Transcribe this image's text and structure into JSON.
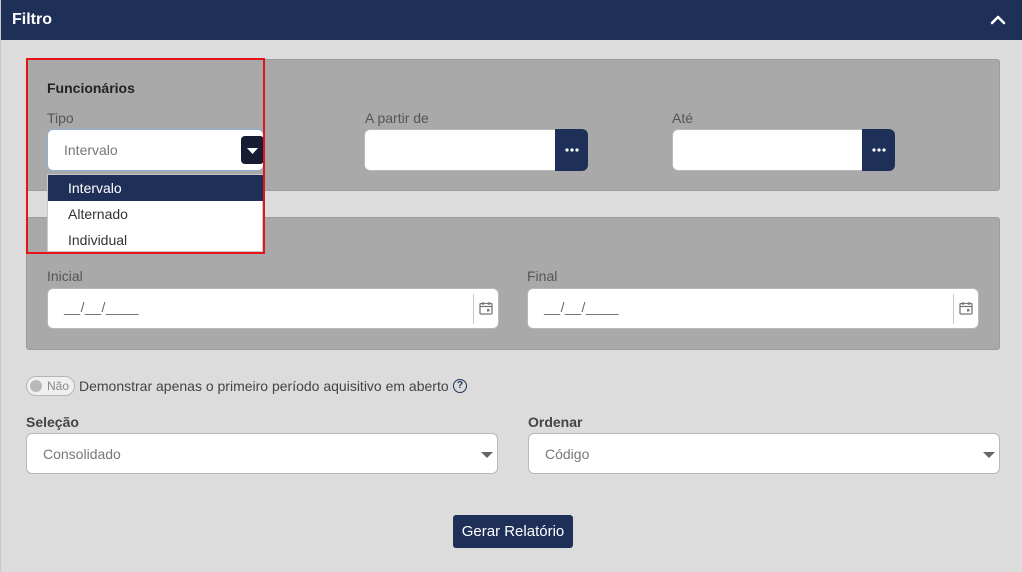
{
  "header": {
    "title": "Filtro",
    "collapse_icon": "chevron-up-icon"
  },
  "funcionarios": {
    "title": "Funcionários",
    "tipo_label": "Tipo",
    "tipo_value": "Intervalo",
    "a_partir_label": "A partir de",
    "a_partir_value": "",
    "ate_label": "Até",
    "ate_value": "",
    "more_icon": "ellipsis-icon"
  },
  "tipo_dropdown": {
    "options": [
      "Intervalo",
      "Alternado",
      "Individual"
    ],
    "selected_index": 0
  },
  "periodo": {
    "inicial_label": "Inicial",
    "inicial_mask": "__/__/____",
    "final_label": "Final",
    "final_mask": "__/__/____",
    "calendar_icon": "calendar-icon"
  },
  "toggle": {
    "state_text": "Não",
    "label": "Demonstrar apenas o primeiro período aquisitivo em aberto",
    "help_icon": "question-icon"
  },
  "selecao": {
    "label": "Seleção",
    "value": "Consolidado"
  },
  "ordenar": {
    "label": "Ordenar",
    "value": "Código"
  },
  "actions": {
    "generate_label": "Gerar Relatório"
  },
  "colors": {
    "primary": "#1f3058",
    "highlight": "#e0141a"
  }
}
